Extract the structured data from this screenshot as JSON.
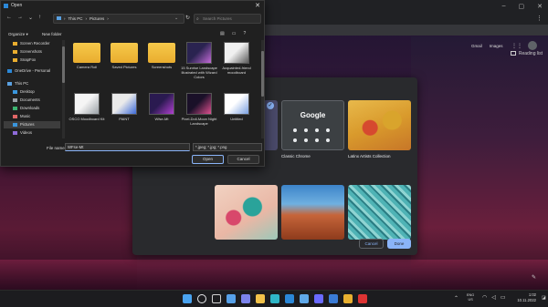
{
  "open_dialog": {
    "title": "Open",
    "address": {
      "items": [
        "This PC",
        "Pictures"
      ],
      "separator": "›"
    },
    "search_placeholder": "Search Pictures",
    "commands": {
      "organize": "Organize ▾",
      "new_folder": "New folder"
    },
    "nav_items": [
      {
        "label": "Screen Recorder",
        "icon": "folder-icon",
        "color": "#e9ad2f"
      },
      {
        "label": "Screenshots",
        "icon": "folder-icon",
        "color": "#e9ad2f"
      },
      {
        "label": "SnapFox",
        "icon": "folder-icon",
        "color": "#e9ad2f"
      },
      {
        "label": "OneDrive - Personal",
        "icon": "cloud-icon",
        "color": "#2b88d8"
      },
      {
        "label": "This PC",
        "icon": "pc-icon",
        "color": "#5aa0e0"
      },
      {
        "label": "Desktop",
        "icon": "desktop-icon",
        "color": "#3a96dd"
      },
      {
        "label": "Documents",
        "icon": "documents-icon",
        "color": "#9aa0a6"
      },
      {
        "label": "Downloads",
        "icon": "downloads-icon",
        "color": "#3cb371"
      },
      {
        "label": "Music",
        "icon": "music-icon",
        "color": "#e06666"
      },
      {
        "label": "Pictures",
        "icon": "pictures-icon",
        "color": "#3a96dd"
      },
      {
        "label": "Videos",
        "icon": "videos-icon",
        "color": "#8e6bd9"
      }
    ],
    "files": [
      {
        "name": "Camera Roll",
        "kind": "folder"
      },
      {
        "name": "Saved Pictures",
        "kind": "folder"
      },
      {
        "name": "Screenshots",
        "kind": "folder"
      },
      {
        "name": "15 Sunrise Landscape Illustrated with Wizard Colors",
        "kind": "image",
        "colors": [
          "#2a2350",
          "#c46bd8"
        ]
      },
      {
        "name": "Acquainted-friend moodboard",
        "kind": "image",
        "colors": [
          "#f0f0f0",
          "#5b5b5b"
        ]
      },
      {
        "name": "OSCO Moodboard Kit",
        "kind": "image",
        "colors": [
          "#f5f5f5",
          "#9aa0a6"
        ]
      },
      {
        "name": "PAINT",
        "kind": "image",
        "colors": [
          "#eaeaea",
          "#3c6ad8"
        ]
      },
      {
        "name": "Wfse-Mt",
        "kind": "image",
        "colors": [
          "#2a1a50",
          "#b040d0"
        ]
      },
      {
        "name": "Pixel-Doll-Moon Night Landscape",
        "kind": "image",
        "colors": [
          "#1a1028",
          "#e05090"
        ]
      },
      {
        "name": "Untitled",
        "kind": "image",
        "colors": [
          "#ffffff",
          "#7aa0e0"
        ]
      }
    ],
    "file_name_label": "File name:",
    "file_name_value": "WFse-Mt",
    "filter_value": "*.jpeg; *.jpg; *.png",
    "open_label": "Open",
    "cancel_label": "Cancel"
  },
  "chrome": {
    "reading_list": "Reading list",
    "ntp_links": [
      "Gmail",
      "Images"
    ]
  },
  "customize": {
    "google_label": "Google",
    "tiles": [
      {
        "label": "Classic Chrome"
      },
      {
        "label": "Latinx Artists Collection"
      }
    ],
    "cancel_label": "Cancel",
    "done_label": "Done"
  },
  "taskbar": {
    "icons": [
      {
        "name": "windows-start-icon",
        "color": "#4aa3f0"
      },
      {
        "name": "search-icon",
        "color": "#e8eaed"
      },
      {
        "name": "task-view-icon",
        "color": "#d0d0d0"
      },
      {
        "name": "widgets-icon",
        "color": "#56a0e8"
      },
      {
        "name": "teams-chat-icon",
        "color": "#7b83eb"
      },
      {
        "name": "file-explorer-icon",
        "color": "#f1c24a"
      },
      {
        "name": "edge-icon",
        "color": "#2fb6c7"
      },
      {
        "name": "mail-icon",
        "color": "#2b88d8"
      },
      {
        "name": "store-icon",
        "color": "#5fa8e8"
      },
      {
        "name": "notes-icon",
        "color": "#6a6aff"
      },
      {
        "name": "calendar-icon",
        "color": "#3a7bd5"
      },
      {
        "name": "chrome-icon",
        "color": "#e8b030"
      },
      {
        "name": "app-icon",
        "color": "#d33"
      }
    ],
    "language": [
      "ENG",
      "US"
    ],
    "time": "1:02",
    "date": "10.11.2022"
  }
}
